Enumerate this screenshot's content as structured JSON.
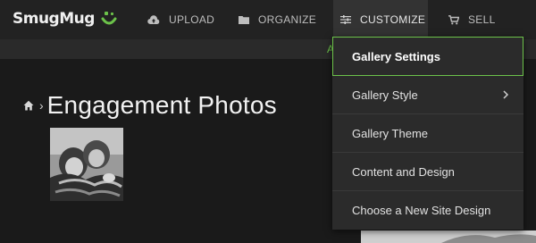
{
  "header": {
    "logo_text": "SmugMug",
    "nav": [
      {
        "label": "UPLOAD",
        "icon": "cloud-upload-icon"
      },
      {
        "label": "ORGANIZE",
        "icon": "folder-icon"
      },
      {
        "label": "CUSTOMIZE",
        "icon": "sliders-icon"
      },
      {
        "label": "SELL",
        "icon": "cart-icon"
      }
    ],
    "subbar_text": "A"
  },
  "page": {
    "breadcrumb_icon": "home-icon",
    "breadcrumb_separator": "›",
    "title": "Engagement Photos"
  },
  "customize_menu": {
    "items": [
      {
        "label": "Gallery Settings",
        "active": true
      },
      {
        "label": "Gallery Style",
        "has_submenu": true
      },
      {
        "label": "Gallery Theme"
      },
      {
        "label": "Content and Design"
      },
      {
        "label": "Choose a New Site Design"
      }
    ]
  },
  "colors": {
    "accent": "#6cc24a",
    "background": "#1c1c1c",
    "menu_background": "#2b2b2b"
  }
}
